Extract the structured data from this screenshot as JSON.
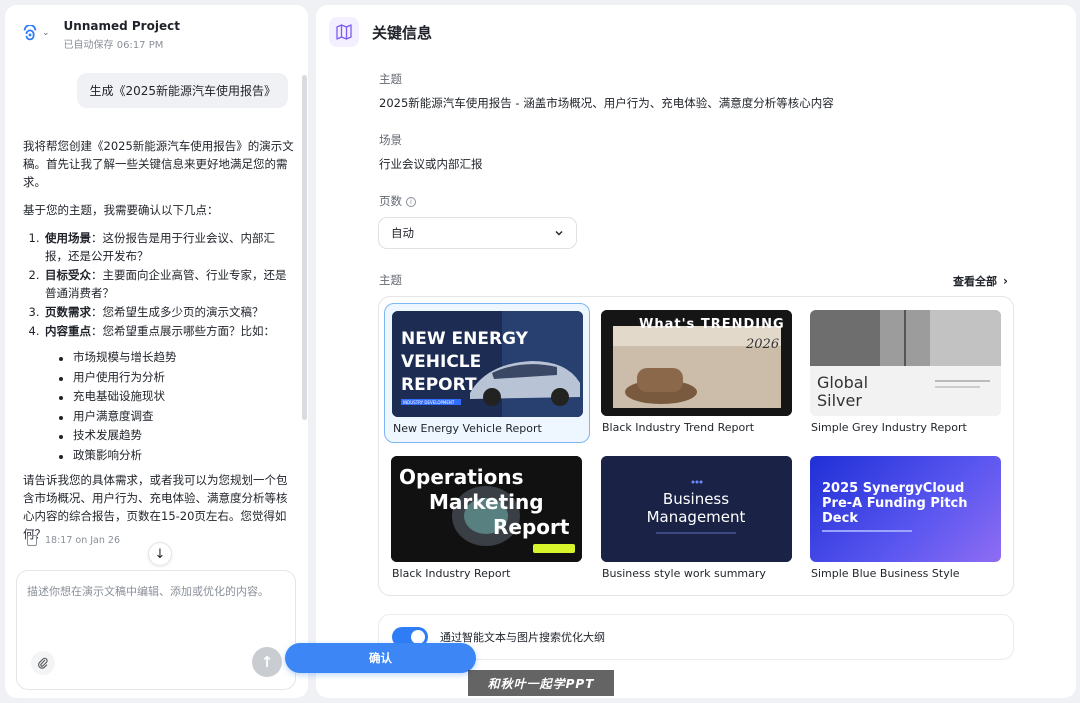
{
  "project": {
    "name": "Unnamed Project",
    "save_status": "已自动保存 06:17 PM"
  },
  "chat": {
    "user_message": "生成《2025新能源汽车使用报告》",
    "reply_intro": "我将帮您创建《2025新能源汽车使用报告》的演示文稿。首先让我了解一些关键信息来更好地满足您的需求。",
    "reply_confirm": "基于您的主题，我需要确认以下几点：",
    "questions": [
      {
        "num": "1.",
        "title": "使用场景",
        "text": "：这份报告是用于行业会议、内部汇报，还是公开发布？"
      },
      {
        "num": "2.",
        "title": "目标受众",
        "text": "：主要面向企业高管、行业专家，还是普通消费者？"
      },
      {
        "num": "3.",
        "title": "页数需求",
        "text": "：您希望生成多少页的演示文稿？"
      },
      {
        "num": "4.",
        "title": "内容重点",
        "text": "：您希望重点展示哪些方面？比如："
      }
    ],
    "bullets": [
      "市场规模与增长趋势",
      "用户使用行为分析",
      "充电基础设施现状",
      "用户满意度调查",
      "技术发展趋势",
      "政策影响分析"
    ],
    "reply_closing": "请告诉我您的具体需求，或者我可以为您规划一个包含市场概况、用户行为、充电体验、满意度分析等核心内容的综合报告，页数在15-20页左右。您觉得如何？",
    "timestamp": "18:17 on Jan 26"
  },
  "input": {
    "placeholder": "描述你想在演示文稿中编辑、添加或优化的内容。"
  },
  "panel": {
    "title": "关键信息",
    "topic_label": "主题",
    "topic_value": "2025新能源汽车使用报告 - 涵盖市场概况、用户行为、充电体验、满意度分析等核心内容",
    "scene_label": "场景",
    "scene_value": "行业会议或内部汇报",
    "pages_label": "页数",
    "pages_value": "自动",
    "theme_label": "主题",
    "view_all": "查看全部",
    "themes": [
      {
        "name": "New Energy Vehicle Report",
        "selected": true
      },
      {
        "name": "Black Industry Trend Report",
        "selected": false
      },
      {
        "name": "Simple Grey Industry Report",
        "selected": false
      },
      {
        "name": "Black Industry Report",
        "selected": false
      },
      {
        "name": "Business style work summary",
        "selected": false
      },
      {
        "name": "Simple Blue Business Style",
        "selected": false
      }
    ],
    "thumb_text": {
      "t1": [
        "NEW ENERGY",
        "VEHICLE",
        "REPORT"
      ],
      "t1_badge": "INDUSTRY DEVELOPMENT",
      "t2_top": "What's TRENDING",
      "t2_year": "2026",
      "t3": [
        "Global",
        "Silver"
      ],
      "t4": [
        "Operations",
        "Marketing",
        "Report"
      ],
      "t5": [
        "Business",
        "Management"
      ],
      "t6": [
        "2025 SynergyCloud",
        "Pre-A Funding Pitch",
        "Deck"
      ]
    },
    "toggle_label": "通过智能文本与图片搜索优化大纲",
    "toggle_on": true,
    "confirm": "确认"
  },
  "watermark": "和秋叶一起学PPT",
  "colors": {
    "accent": "#3c86f5",
    "selected_bg": "#eef6ff"
  }
}
